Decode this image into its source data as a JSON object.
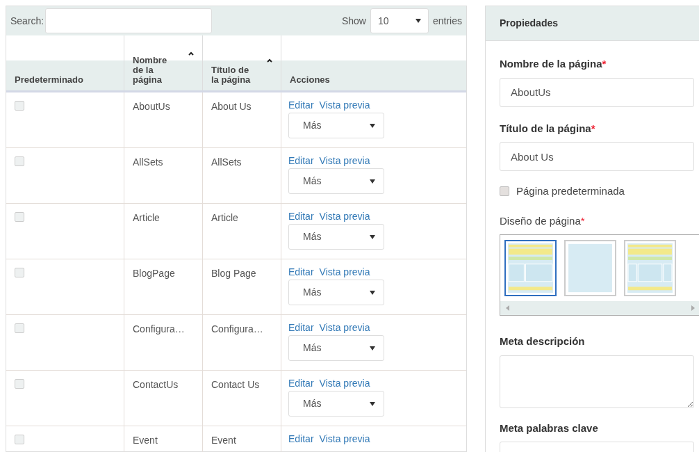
{
  "toolbar": {
    "search_label": "Search:",
    "show_label": "Show",
    "page_size": "10",
    "entries_label": "entries"
  },
  "table": {
    "columns": [
      {
        "label": "Predeterminado",
        "sorted": false
      },
      {
        "label": "Nombre de la página",
        "sorted": true
      },
      {
        "label": "Título de la página",
        "sorted": true
      },
      {
        "label": "Acciones",
        "sorted": false
      }
    ],
    "rows": [
      {
        "checked": false,
        "name": "AboutUs",
        "title": "About Us",
        "edit": "Editar",
        "preview": "Vista previa",
        "more": "Más"
      },
      {
        "checked": false,
        "name": "AllSets",
        "title": "AllSets",
        "edit": "Editar",
        "preview": "Vista previa",
        "more": "Más"
      },
      {
        "checked": false,
        "name": "Article",
        "title": "Article",
        "edit": "Editar",
        "preview": "Vista previa",
        "more": "Más"
      },
      {
        "checked": false,
        "name": "BlogPage",
        "title": "Blog Page",
        "edit": "Editar",
        "preview": "Vista previa",
        "more": "Más"
      },
      {
        "checked": false,
        "name": "Configura…",
        "title": "Configura…",
        "edit": "Editar",
        "preview": "Vista previa",
        "more": "Más"
      },
      {
        "checked": false,
        "name": "ContactUs",
        "title": "Contact Us",
        "edit": "Editar",
        "preview": "Vista previa",
        "more": "Más"
      },
      {
        "checked": false,
        "name": "Event",
        "title": "Event",
        "edit": "Editar",
        "preview": "Vista previa"
      }
    ]
  },
  "properties": {
    "title": "Propiedades",
    "page_name_label": "Nombre de la página",
    "page_name": "AboutUs",
    "page_title_label": "Título de la página",
    "page_title": "About Us",
    "required_mark": "*",
    "default_checkbox": {
      "label": "Página predeterminada",
      "checked": false
    },
    "layout_label": "Diseño de página",
    "layouts": [
      {
        "kind": "two-column",
        "selected": true
      },
      {
        "kind": "blank",
        "selected": false
      },
      {
        "kind": "three-column",
        "selected": false
      }
    ],
    "meta_description_label": "Meta descripción",
    "meta_keywords_label": "Meta palabras clave"
  }
}
